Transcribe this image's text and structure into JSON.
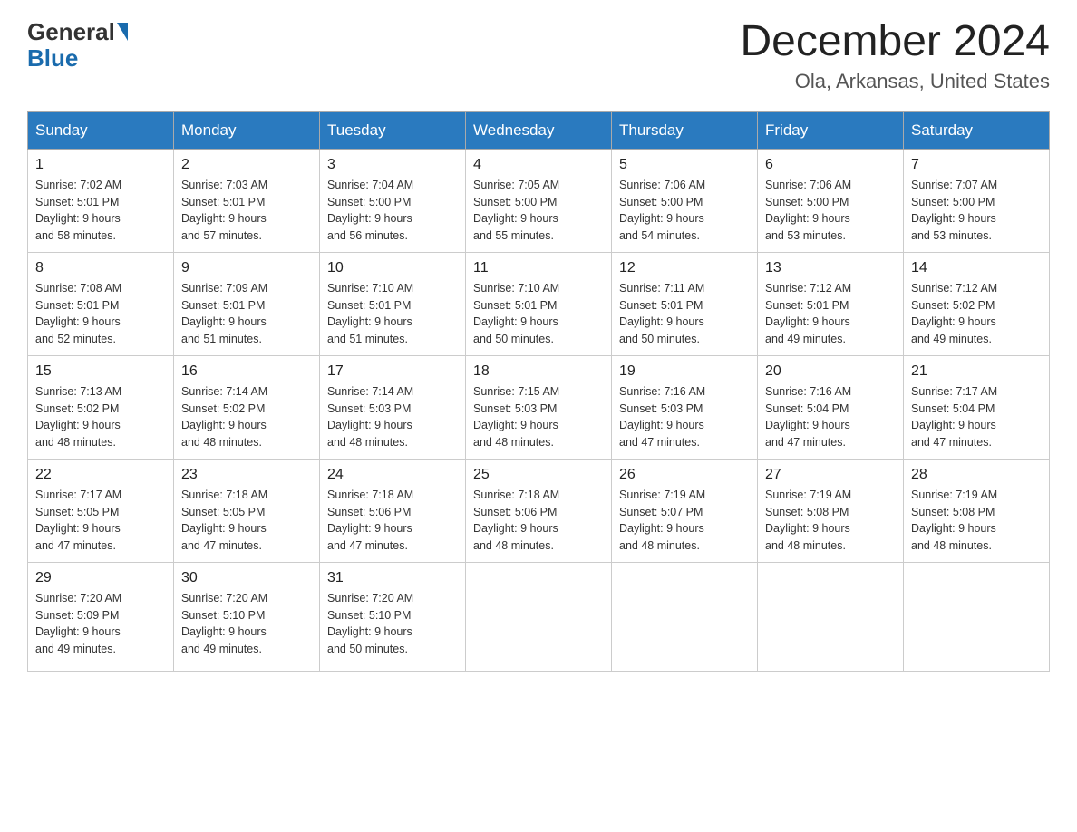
{
  "logo": {
    "general": "General",
    "blue": "Blue"
  },
  "title": "December 2024",
  "subtitle": "Ola, Arkansas, United States",
  "days_of_week": [
    "Sunday",
    "Monday",
    "Tuesday",
    "Wednesday",
    "Thursday",
    "Friday",
    "Saturday"
  ],
  "weeks": [
    [
      {
        "day": 1,
        "info": "Sunrise: 7:02 AM\nSunset: 5:01 PM\nDaylight: 9 hours\nand 58 minutes."
      },
      {
        "day": 2,
        "info": "Sunrise: 7:03 AM\nSunset: 5:01 PM\nDaylight: 9 hours\nand 57 minutes."
      },
      {
        "day": 3,
        "info": "Sunrise: 7:04 AM\nSunset: 5:00 PM\nDaylight: 9 hours\nand 56 minutes."
      },
      {
        "day": 4,
        "info": "Sunrise: 7:05 AM\nSunset: 5:00 PM\nDaylight: 9 hours\nand 55 minutes."
      },
      {
        "day": 5,
        "info": "Sunrise: 7:06 AM\nSunset: 5:00 PM\nDaylight: 9 hours\nand 54 minutes."
      },
      {
        "day": 6,
        "info": "Sunrise: 7:06 AM\nSunset: 5:00 PM\nDaylight: 9 hours\nand 53 minutes."
      },
      {
        "day": 7,
        "info": "Sunrise: 7:07 AM\nSunset: 5:00 PM\nDaylight: 9 hours\nand 53 minutes."
      }
    ],
    [
      {
        "day": 8,
        "info": "Sunrise: 7:08 AM\nSunset: 5:01 PM\nDaylight: 9 hours\nand 52 minutes."
      },
      {
        "day": 9,
        "info": "Sunrise: 7:09 AM\nSunset: 5:01 PM\nDaylight: 9 hours\nand 51 minutes."
      },
      {
        "day": 10,
        "info": "Sunrise: 7:10 AM\nSunset: 5:01 PM\nDaylight: 9 hours\nand 51 minutes."
      },
      {
        "day": 11,
        "info": "Sunrise: 7:10 AM\nSunset: 5:01 PM\nDaylight: 9 hours\nand 50 minutes."
      },
      {
        "day": 12,
        "info": "Sunrise: 7:11 AM\nSunset: 5:01 PM\nDaylight: 9 hours\nand 50 minutes."
      },
      {
        "day": 13,
        "info": "Sunrise: 7:12 AM\nSunset: 5:01 PM\nDaylight: 9 hours\nand 49 minutes."
      },
      {
        "day": 14,
        "info": "Sunrise: 7:12 AM\nSunset: 5:02 PM\nDaylight: 9 hours\nand 49 minutes."
      }
    ],
    [
      {
        "day": 15,
        "info": "Sunrise: 7:13 AM\nSunset: 5:02 PM\nDaylight: 9 hours\nand 48 minutes."
      },
      {
        "day": 16,
        "info": "Sunrise: 7:14 AM\nSunset: 5:02 PM\nDaylight: 9 hours\nand 48 minutes."
      },
      {
        "day": 17,
        "info": "Sunrise: 7:14 AM\nSunset: 5:03 PM\nDaylight: 9 hours\nand 48 minutes."
      },
      {
        "day": 18,
        "info": "Sunrise: 7:15 AM\nSunset: 5:03 PM\nDaylight: 9 hours\nand 48 minutes."
      },
      {
        "day": 19,
        "info": "Sunrise: 7:16 AM\nSunset: 5:03 PM\nDaylight: 9 hours\nand 47 minutes."
      },
      {
        "day": 20,
        "info": "Sunrise: 7:16 AM\nSunset: 5:04 PM\nDaylight: 9 hours\nand 47 minutes."
      },
      {
        "day": 21,
        "info": "Sunrise: 7:17 AM\nSunset: 5:04 PM\nDaylight: 9 hours\nand 47 minutes."
      }
    ],
    [
      {
        "day": 22,
        "info": "Sunrise: 7:17 AM\nSunset: 5:05 PM\nDaylight: 9 hours\nand 47 minutes."
      },
      {
        "day": 23,
        "info": "Sunrise: 7:18 AM\nSunset: 5:05 PM\nDaylight: 9 hours\nand 47 minutes."
      },
      {
        "day": 24,
        "info": "Sunrise: 7:18 AM\nSunset: 5:06 PM\nDaylight: 9 hours\nand 47 minutes."
      },
      {
        "day": 25,
        "info": "Sunrise: 7:18 AM\nSunset: 5:06 PM\nDaylight: 9 hours\nand 48 minutes."
      },
      {
        "day": 26,
        "info": "Sunrise: 7:19 AM\nSunset: 5:07 PM\nDaylight: 9 hours\nand 48 minutes."
      },
      {
        "day": 27,
        "info": "Sunrise: 7:19 AM\nSunset: 5:08 PM\nDaylight: 9 hours\nand 48 minutes."
      },
      {
        "day": 28,
        "info": "Sunrise: 7:19 AM\nSunset: 5:08 PM\nDaylight: 9 hours\nand 48 minutes."
      }
    ],
    [
      {
        "day": 29,
        "info": "Sunrise: 7:20 AM\nSunset: 5:09 PM\nDaylight: 9 hours\nand 49 minutes."
      },
      {
        "day": 30,
        "info": "Sunrise: 7:20 AM\nSunset: 5:10 PM\nDaylight: 9 hours\nand 49 minutes."
      },
      {
        "day": 31,
        "info": "Sunrise: 7:20 AM\nSunset: 5:10 PM\nDaylight: 9 hours\nand 50 minutes."
      },
      null,
      null,
      null,
      null
    ]
  ]
}
